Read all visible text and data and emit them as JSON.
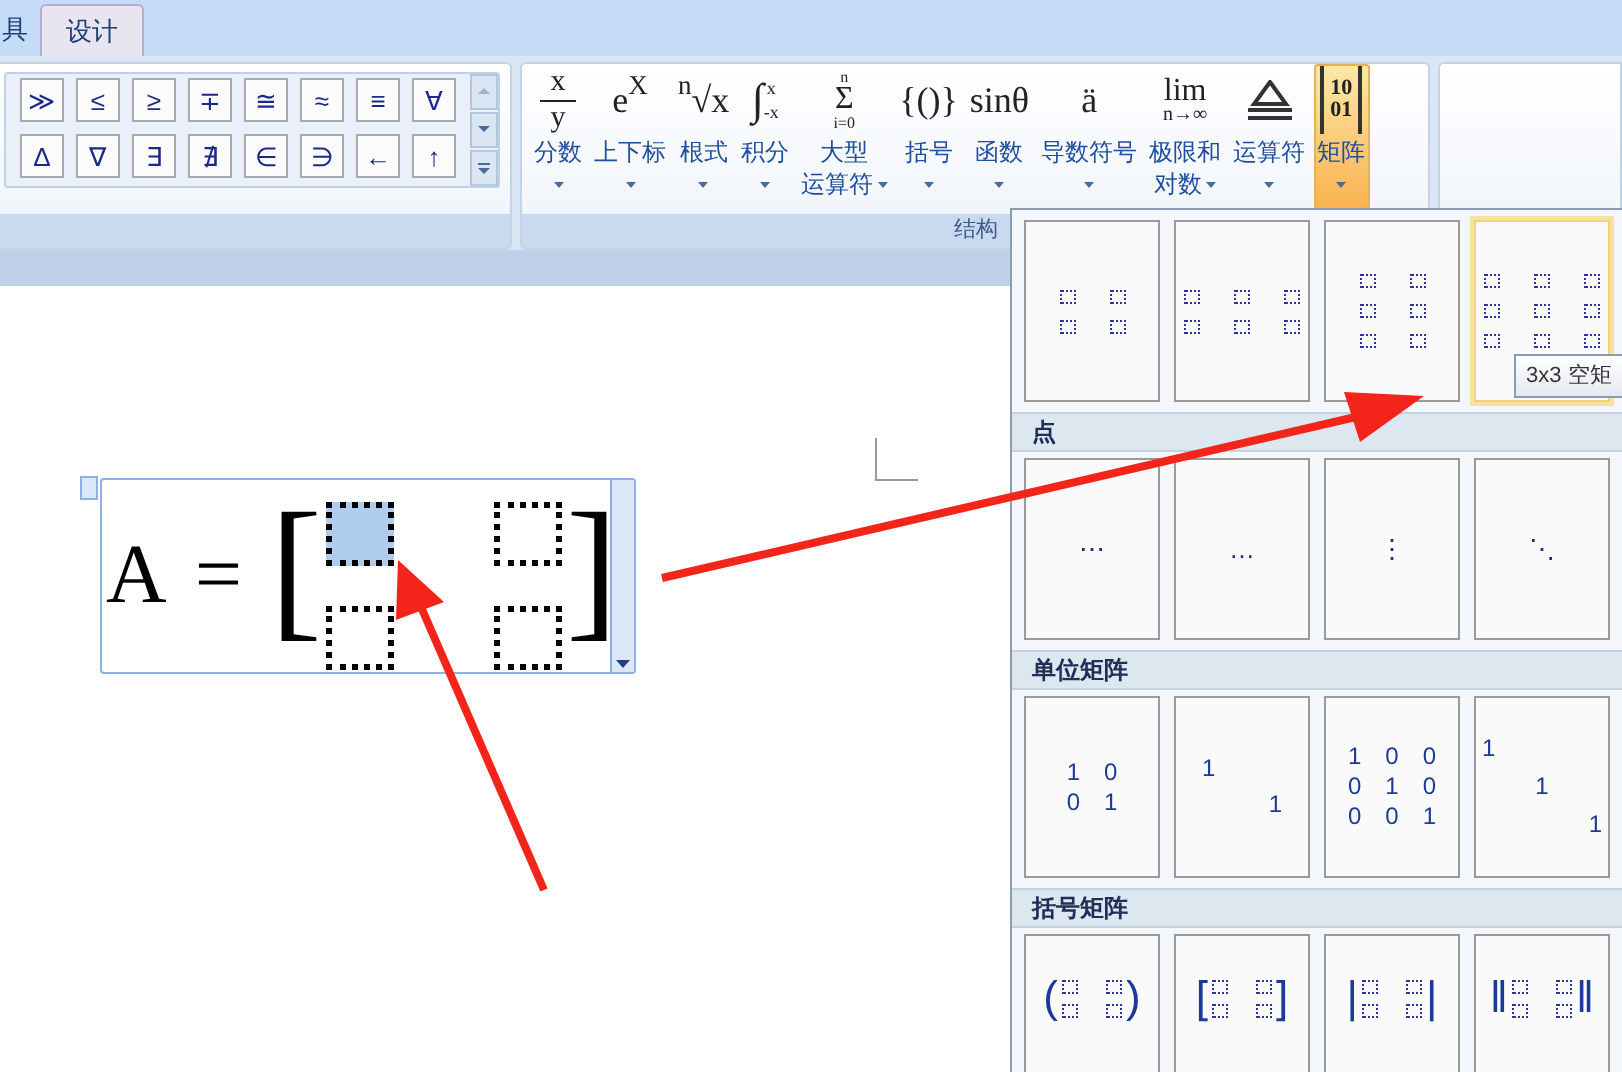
{
  "tabs": [
    {
      "label": "具",
      "selected": false
    },
    {
      "label": "设计",
      "selected": true
    }
  ],
  "symbols": {
    "rows": [
      [
        "≫",
        "≤",
        "≥",
        "∓",
        "≅",
        "≈",
        "≡",
        "∀"
      ],
      [
        "Δ",
        "∇",
        "∃",
        "∄",
        "∈",
        "∋",
        "←",
        "↑"
      ]
    ]
  },
  "structures": {
    "label": "结构",
    "buttons": [
      {
        "kind": "fraction",
        "glyph": [
          "x",
          "y"
        ],
        "label": [
          "分数"
        ],
        "selected": false
      },
      {
        "kind": "text",
        "glyph": [
          "e$^{X}$"
        ],
        "label": [
          "上下标"
        ],
        "selected": false
      },
      {
        "kind": "text",
        "glyph": [
          "$^{n}$√x"
        ],
        "label": [
          "根式"
        ],
        "selected": false
      },
      {
        "kind": "integral",
        "glyph": [
          "∫",
          "x",
          "-x"
        ],
        "label": [
          "积分"
        ],
        "selected": false
      },
      {
        "kind": "stack",
        "glyph": [
          "n",
          "Σ",
          "i=0"
        ],
        "label": [
          "大型",
          "运算符"
        ],
        "selected": false
      },
      {
        "kind": "text",
        "glyph": [
          "{()}"
        ],
        "label": [
          "括号"
        ],
        "selected": false
      },
      {
        "kind": "text",
        "glyph": [
          "sinθ"
        ],
        "label": [
          "函数"
        ],
        "selected": false
      },
      {
        "kind": "text",
        "glyph": [
          "ä"
        ],
        "label": [
          "导数符号"
        ],
        "selected": false
      },
      {
        "kind": "stack",
        "glyph": [
          "lim",
          "n→∞"
        ],
        "label": [
          "极限和",
          "对数"
        ],
        "selected": false
      },
      {
        "kind": "operator",
        "label": [
          "运算符"
        ],
        "selected": false
      },
      {
        "kind": "matrix",
        "glyph": [
          "10",
          "01"
        ],
        "label": [
          "矩阵"
        ],
        "selected": true
      }
    ]
  },
  "equation": {
    "lhs": "A",
    "relation": "=",
    "left_bracket": "[",
    "right_bracket": "]",
    "cells": [
      {
        "selected": true
      },
      {
        "selected": false
      },
      {
        "selected": false
      },
      {
        "selected": false
      }
    ]
  },
  "gallery": {
    "sections": [
      {
        "items": [
          {
            "kind": "twobytwo",
            "hovered": false
          },
          {
            "kind": "threebytwo",
            "hovered": false
          },
          {
            "kind": "twobythree",
            "hovered": false
          },
          {
            "kind": "threebythree",
            "hovered": true
          }
        ]
      },
      {
        "header": "点",
        "items": [
          {
            "kind": "glyph",
            "glyph": "⋯",
            "hovered": false
          },
          {
            "kind": "glyph",
            "glyph": "…",
            "hovered": false
          },
          {
            "kind": "glyph",
            "glyph": "⋮",
            "hovered": false
          },
          {
            "kind": "glyph",
            "glyph": "⋱",
            "hovered": false
          }
        ]
      },
      {
        "header": "单位矩阵",
        "items": [
          {
            "kind": "grid",
            "rows": [
              [
                "1",
                "0"
              ],
              [
                "0",
                "1"
              ]
            ],
            "hovered": false
          },
          {
            "kind": "diagonal",
            "values": [
              "1",
              "1"
            ],
            "hovered": false
          },
          {
            "kind": "grid",
            "rows": [
              [
                "1",
                "0",
                "0"
              ],
              [
                "0",
                "1",
                "0"
              ],
              [
                "0",
                "0",
                "1"
              ]
            ],
            "hovered": false
          },
          {
            "kind": "diagonal",
            "values": [
              "1",
              "1",
              "1"
            ],
            "hovered": false
          }
        ]
      },
      {
        "header": "括号矩阵",
        "items": [
          {
            "kind": "bracketed",
            "left": "(",
            "right": ")",
            "hovered": false
          },
          {
            "kind": "bracketed",
            "left": "[",
            "right": "]",
            "hovered": false
          },
          {
            "kind": "bracketed",
            "left": "|",
            "right": "|",
            "hovered": false
          },
          {
            "kind": "bracketed",
            "left": "‖",
            "right": "‖",
            "hovered": false
          }
        ]
      }
    ]
  },
  "tooltip": "3x3 空矩"
}
